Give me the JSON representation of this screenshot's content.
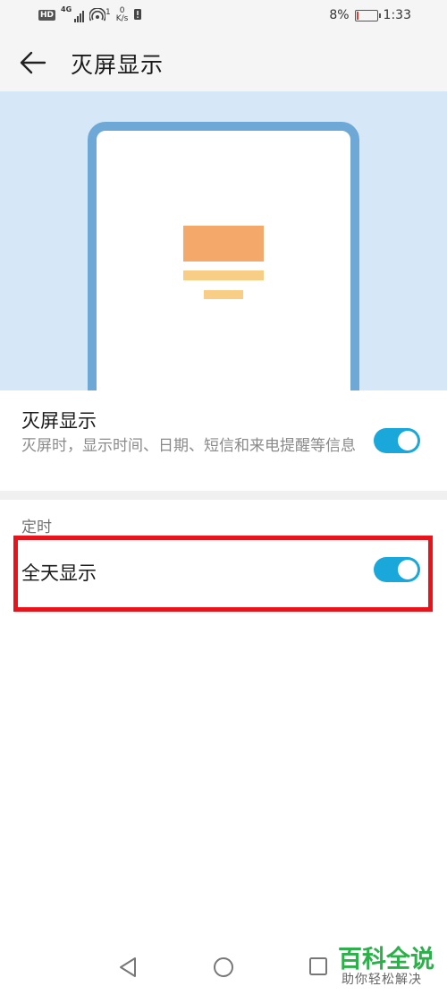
{
  "status_bar": {
    "hd": "HD",
    "network_type": "4G",
    "hotspot_count": "1",
    "speed_value": "0",
    "speed_unit": "K/s",
    "battery_percent": "8%",
    "battery_level": 0.08,
    "time": "1:33"
  },
  "header": {
    "title": "灭屏显示"
  },
  "settings": {
    "aod": {
      "title": "灭屏显示",
      "description": "灭屏时，显示时间、日期、短信和来电提醒等信息",
      "enabled": true
    },
    "schedule_section": "定时",
    "all_day": {
      "title": "全天显示",
      "enabled": true
    }
  },
  "colors": {
    "accent": "#1aa7d9",
    "highlight": "#e8141b",
    "illustration_bg": "#d6e8f8",
    "phone_frame": "#6ea8d6"
  },
  "watermark": {
    "title": "百科全说",
    "subtitle": "助你轻松解决"
  }
}
